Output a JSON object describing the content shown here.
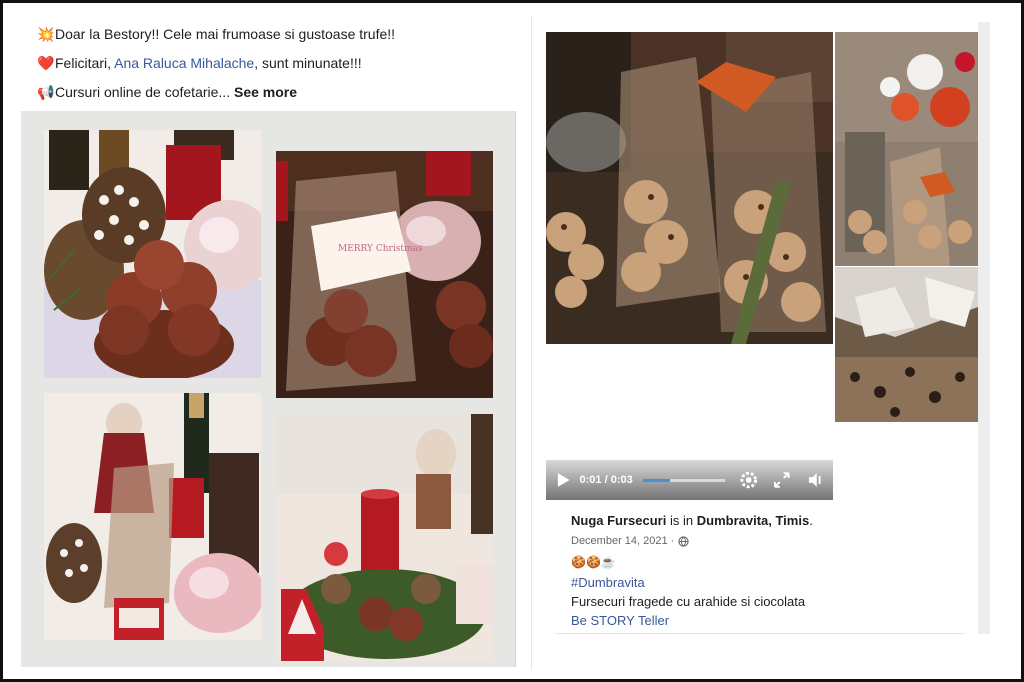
{
  "left_post": {
    "lines": [
      {
        "emoji": "💥",
        "text": "Doar la Bestory!! Cele mai frumoase si gustoase trufe!!"
      },
      {
        "emoji": "❤️",
        "prefix": "Felicitari, ",
        "link": "Ana Raluca Mihalache",
        "suffix": ", sunt minunate!!!"
      },
      {
        "emoji": "📢",
        "text": "Cursuri online de cofetarie...",
        "more": "See more"
      }
    ],
    "photos": [
      {
        "alt": "Chocolate truffles with pinecone, candle and pink apple"
      },
      {
        "alt": "Gift bag with Merry Christmas tag and truffles"
      },
      {
        "alt": "Christmas arrangement with santa, champagne and gift bag"
      },
      {
        "alt": "Red candle table centrepiece with truffles and tree tag"
      }
    ],
    "tag_text": "MERRY Christmas"
  },
  "right_post": {
    "video": {
      "time": "0:01 / 0:03",
      "progress": 0.33
    },
    "author": "Nuga Fursecuri",
    "is_in": "is in",
    "location": "Dumbravita, Timis",
    "period": ".",
    "date": "December 14, 2021 ·",
    "emojis": "🍪🍪☕",
    "hashtag": "#Dumbravita",
    "body": "Fursecuri fragede cu arahide si ciocolata",
    "cta": "Be STORY Teller"
  },
  "colors": {
    "link": "#385898",
    "progress": "#4a90d9",
    "candle_red": "#b51a22"
  },
  "icons": [
    "play-icon",
    "settings-icon",
    "fullscreen-icon",
    "volume-icon",
    "globe-icon"
  ]
}
